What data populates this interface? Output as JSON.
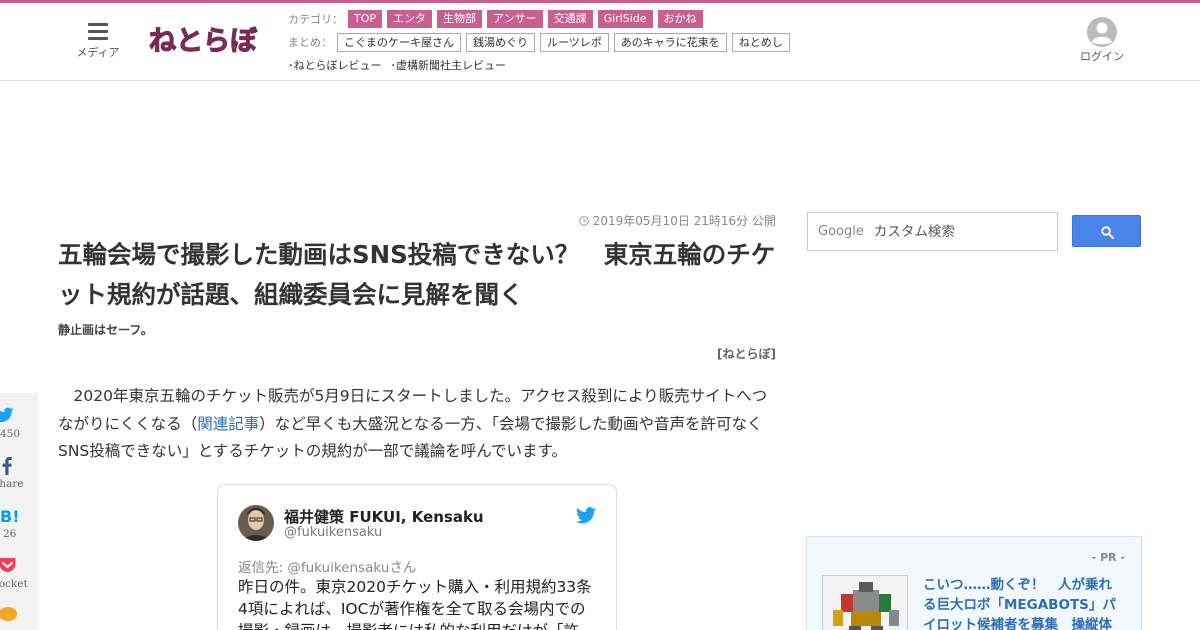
{
  "header": {
    "menu_label": "メディア",
    "logo_text": "ねとらぼ",
    "category_label": "カテゴリ：",
    "categories": [
      "TOP",
      "エンタ",
      "生物部",
      "アンサー",
      "交通課",
      "GirlSide",
      "おかね"
    ],
    "summary_label": "まとめ：",
    "summaries": [
      "こぐまのケーキ屋さん",
      "銭湯めぐり",
      "ルーツレポ",
      "あのキャラに花束を",
      "ねとめし"
    ],
    "reviews": [
      "･ねとらぼレビュー",
      "･虚構新聞社主レビュー"
    ],
    "login_label": "ログイン"
  },
  "article": {
    "date": "2019年05月10日 21時16分 公開",
    "title": "五輪会場で撮影した動画はSNS投稿できない？　東京五輪のチケット規約が話題、組織委員会に見解を聞く",
    "subtitle": "静止画はセーフ。",
    "byline": "[ねとらぼ]",
    "para_before": "　2020年東京五輪のチケット販売が5月9日にスタートしました。アクセス殺到により販売サイトへつながりにくくなる（",
    "para_link": "関連記事",
    "para_after": "）など早くも大盛況となる一方、「会場で撮影した動画や音声を許可なくSNS投稿できない」とするチケットの規約が一部で議論を呼んでいます。"
  },
  "share": {
    "twitter_label": "450",
    "facebook_label": "share",
    "hatena_label": "26",
    "pocket_label": "pocket"
  },
  "tweet": {
    "name": "福井健策 FUKUI, Kensaku",
    "handle": "@fukuikensaku",
    "reply_to": "返信先: @fukuikensakuさん",
    "text": "昨日の件。東京2020チケット購入・利用規約33条4項によれば、IOCが著作権を全て取る会場内での撮影・録画は、撮影者には私的な利用だけが「許"
  },
  "search": {
    "google_label": "Google",
    "placeholder": "カスタム検索"
  },
  "pr": {
    "label": "- PR -",
    "text": "こいつ……動くぞ！　人が乗れる巨大ロボ「MEGABOTS」パイロット候補者を募集　操縦体"
  },
  "colors": {
    "brand": "#c7608f",
    "link": "#2a6fb8",
    "search_button": "#4a84e8",
    "twitter": "#1da1f2"
  }
}
